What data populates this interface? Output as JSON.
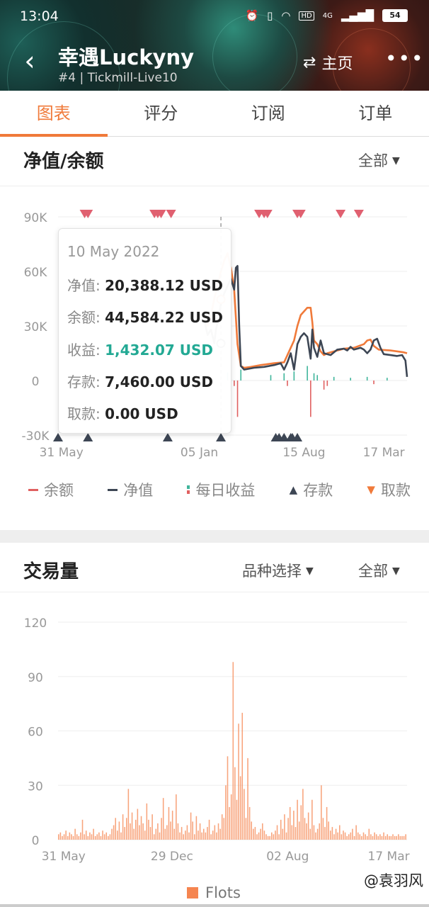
{
  "status_bar": {
    "time": "13:04",
    "alarm_icon": "alarm-icon",
    "vibrate_icon": "vibrate-icon",
    "wifi_icon": "wifi-icon",
    "hd_label": "HD",
    "network_label": "4G",
    "signal_icon": "signal-icon",
    "battery": "54"
  },
  "nav": {
    "back_icon": "back-arrow-icon",
    "title": "幸遇Luckyny",
    "subtitle": "#4 | Tickmill-Live10",
    "home_icon": "swap-arrows-icon",
    "home_label": "主页",
    "more_icon": "more-dots-icon"
  },
  "tabs": [
    {
      "label": "图表",
      "active": true
    },
    {
      "label": "评分",
      "active": false
    },
    {
      "label": "订阅",
      "active": false
    },
    {
      "label": "订单",
      "active": false
    }
  ],
  "equity_section": {
    "title": "净值/余额",
    "filter_label": "全部"
  },
  "tooltip": {
    "date": "10 May 2022",
    "rows": [
      {
        "key": "净值:",
        "value": "20,388.12 USD"
      },
      {
        "key": "余额:",
        "value": "44,584.22 USD"
      },
      {
        "key": "收益:",
        "value": "1,432.07 USD"
      },
      {
        "key": "存款:",
        "value": "7,460.00 USD"
      },
      {
        "key": "取款:",
        "value": "0.00 USD"
      }
    ]
  },
  "legend": [
    {
      "label": "余额",
      "color": "#e06060"
    },
    {
      "label": "净值",
      "color": "#3d4654"
    },
    {
      "label": "每日收益",
      "color": "#3fb59b"
    },
    {
      "label": "存款",
      "color": "#3d4654"
    },
    {
      "label": "取款",
      "color": "#f07a3a"
    }
  ],
  "volume_section": {
    "title": "交易量",
    "symbol_filter_label": "品种选择",
    "filter_label": "全部",
    "legend_label": "Flots"
  },
  "watermark": "@袁羽风",
  "colors": {
    "accent": "#f07a3a",
    "balance": "#f07a3a",
    "equity": "#3d4654",
    "profit_positive": "#3fb59b",
    "profit_negative": "#e06060",
    "withdraw_marker": "#e06070",
    "deposit_marker": "#3d4654",
    "volume": "#f58550"
  },
  "chart_data": [
    {
      "type": "line",
      "title": "净值/余额",
      "y_ticks": [
        "90K",
        "60K",
        "30K",
        "0",
        "-30K"
      ],
      "y_tick_values": [
        90000,
        60000,
        30000,
        0,
        -30000
      ],
      "ylim": [
        -30000,
        90000
      ],
      "x_tick_labels": [
        "31 May",
        "05 Jan",
        "15 Aug",
        "17 Mar"
      ],
      "x_tick_index": [
        2,
        85,
        148,
        196
      ],
      "x_range": [
        0,
        210
      ],
      "series": [
        {
          "name": "余额",
          "color": "#f07a3a",
          "points": [
            [
              88,
              33000
            ],
            [
              90,
              30000
            ],
            [
              92,
              36000
            ],
            [
              94,
              45000
            ],
            [
              96,
              52000
            ],
            [
              98,
              60000
            ],
            [
              100,
              66000
            ],
            [
              102,
              70000
            ],
            [
              104,
              62000
            ],
            [
              106,
              50000
            ],
            [
              108,
              20000
            ],
            [
              110,
              8000
            ],
            [
              112,
              7000
            ],
            [
              116,
              7500
            ],
            [
              122,
              8500
            ],
            [
              130,
              9500
            ],
            [
              136,
              10000
            ],
            [
              138,
              14000
            ],
            [
              140,
              18000
            ],
            [
              142,
              22000
            ],
            [
              144,
              30000
            ],
            [
              146,
              36000
            ],
            [
              148,
              38000
            ],
            [
              150,
              40000
            ],
            [
              152,
              40000
            ],
            [
              153,
              32000
            ],
            [
              154,
              22000
            ],
            [
              156,
              20000
            ],
            [
              158,
              16000
            ],
            [
              160,
              14000
            ],
            [
              162,
              15000
            ],
            [
              166,
              16000
            ],
            [
              172,
              17500
            ],
            [
              178,
              18000
            ],
            [
              184,
              20000
            ],
            [
              186,
              22000
            ],
            [
              188,
              22500
            ],
            [
              190,
              19000
            ],
            [
              193,
              17000
            ],
            [
              200,
              16500
            ],
            [
              208,
              15500
            ],
            [
              210,
              15000
            ]
          ]
        },
        {
          "name": "净值",
          "color": "#3d4654",
          "points": [
            [
              88,
              33000
            ],
            [
              90,
              25000
            ],
            [
              92,
              28000
            ],
            [
              94,
              20500
            ],
            [
              95,
              28000
            ],
            [
              96,
              32000
            ],
            [
              98,
              42000
            ],
            [
              100,
              48000
            ],
            [
              102,
              52000
            ],
            [
              104,
              56000
            ],
            [
              106,
              50000
            ],
            [
              107,
              62000
            ],
            [
              108,
              63000
            ],
            [
              109,
              30000
            ],
            [
              110,
              8000
            ],
            [
              112,
              6000
            ],
            [
              118,
              7000
            ],
            [
              124,
              7500
            ],
            [
              130,
              8500
            ],
            [
              134,
              9500
            ],
            [
              136,
              6000
            ],
            [
              138,
              10000
            ],
            [
              140,
              15000
            ],
            [
              142,
              6000
            ],
            [
              144,
              20000
            ],
            [
              146,
              24000
            ],
            [
              148,
              26000
            ],
            [
              150,
              24000
            ],
            [
              152,
              12000
            ],
            [
              153,
              28000
            ],
            [
              154,
              18000
            ],
            [
              156,
              13000
            ],
            [
              158,
              22000
            ],
            [
              160,
              15000
            ],
            [
              164,
              14000
            ],
            [
              168,
              17000
            ],
            [
              172,
              17500
            ],
            [
              174,
              16500
            ],
            [
              176,
              18500
            ],
            [
              178,
              17000
            ],
            [
              182,
              18000
            ],
            [
              184,
              17000
            ],
            [
              186,
              15000
            ],
            [
              188,
              17000
            ],
            [
              190,
              22000
            ],
            [
              192,
              23000
            ],
            [
              194,
              18000
            ],
            [
              196,
              14500
            ],
            [
              200,
              14000
            ],
            [
              204,
              13500
            ],
            [
              207,
              14000
            ],
            [
              209,
              11000
            ],
            [
              210,
              2000
            ]
          ]
        }
      ],
      "daily_profit": [
        [
          102,
          4500
        ],
        [
          104,
          -6000
        ],
        [
          106,
          -3000
        ],
        [
          108,
          -20000
        ],
        [
          110,
          6000
        ],
        [
          128,
          3000
        ],
        [
          136,
          4000
        ],
        [
          138,
          -3000
        ],
        [
          142,
          5000
        ],
        [
          150,
          8000
        ],
        [
          152,
          -20000
        ],
        [
          154,
          4000
        ],
        [
          156,
          3000
        ],
        [
          160,
          -5000
        ],
        [
          162,
          -3000
        ],
        [
          166,
          2000
        ],
        [
          176,
          1500
        ],
        [
          186,
          2000
        ],
        [
          190,
          -2000
        ],
        [
          198,
          1500
        ]
      ],
      "withdraw_markers": [
        16,
        18,
        58,
        60,
        62,
        68,
        121,
        124,
        126,
        144,
        146,
        170,
        181
      ],
      "deposit_markers": [
        0,
        18,
        66,
        98,
        131,
        133,
        136,
        140,
        141,
        144
      ],
      "tooltip_x": 98
    },
    {
      "type": "bar",
      "title": "交易量",
      "series_name": "Flots",
      "y_ticks": [
        "120",
        "90",
        "60",
        "30",
        "0"
      ],
      "y_tick_values": [
        120,
        90,
        60,
        30,
        0
      ],
      "ylim": [
        0,
        120
      ],
      "x_tick_labels": [
        "31 May",
        "29 Dec",
        "02 Aug",
        "17 Mar"
      ],
      "x_tick_index": [
        3,
        62,
        125,
        180
      ],
      "x_range": [
        0,
        190
      ],
      "values": [
        3,
        4,
        2,
        3,
        5,
        2,
        4,
        3,
        2,
        6,
        3,
        2,
        4,
        11,
        3,
        5,
        2,
        4,
        3,
        6,
        2,
        3,
        4,
        2,
        5,
        3,
        4,
        2,
        3,
        6,
        8,
        12,
        5,
        10,
        4,
        14,
        7,
        12,
        28,
        9,
        15,
        6,
        11,
        17,
        8,
        13,
        9,
        5,
        20,
        11,
        7,
        14,
        3,
        6,
        9,
        4,
        12,
        23,
        6,
        8,
        18,
        10,
        16,
        6,
        25,
        9,
        4,
        7,
        3,
        5,
        8,
        4,
        15,
        10,
        3,
        13,
        5,
        9,
        4,
        6,
        4,
        7,
        11,
        3,
        5,
        8,
        4,
        9,
        6,
        14,
        12,
        30,
        46,
        18,
        25,
        98,
        40,
        22,
        64,
        35,
        70,
        28,
        12,
        45,
        18,
        10,
        6,
        7,
        3,
        4,
        6,
        9,
        5,
        3,
        2,
        2,
        4,
        3,
        5,
        8,
        3,
        11,
        6,
        14,
        4,
        12,
        18,
        8,
        16,
        7,
        22,
        10,
        19,
        28,
        12,
        9,
        15,
        6,
        22,
        8,
        4,
        6,
        9,
        30,
        12,
        7,
        18,
        10,
        5,
        7,
        3,
        6,
        4,
        8,
        3,
        5,
        4,
        2,
        3,
        4,
        6,
        2,
        8,
        4,
        3,
        2,
        4,
        3,
        2,
        6,
        3,
        2,
        4,
        3,
        2,
        3,
        2,
        4,
        2,
        3,
        2,
        2,
        3,
        2,
        2,
        3,
        2,
        2,
        2,
        3
      ]
    }
  ]
}
